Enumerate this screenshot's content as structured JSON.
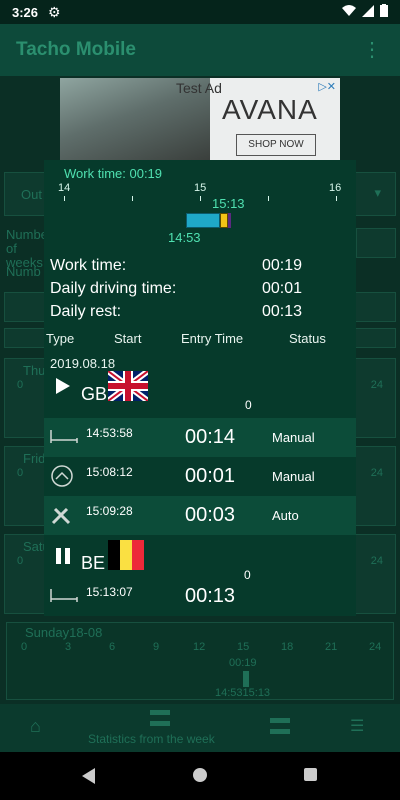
{
  "status_bar": {
    "time": "3:26"
  },
  "app_bar": {
    "title": "Tacho Mobile"
  },
  "ad": {
    "label": "Test Ad",
    "brand": "AVANA",
    "cta": "SHOP NOW"
  },
  "background": {
    "out_label": "Out",
    "number_weeks": "Number of weeks",
    "number": "Numb",
    "days": [
      "Thu",
      "Frid",
      "Satu"
    ],
    "hour_24": "24",
    "hour_0": "0"
  },
  "dialog": {
    "work_time_label": "Work time: 00:19",
    "timeline": {
      "ticks": [
        "14",
        "15",
        "16"
      ],
      "end_time": "15:13",
      "start_time": "14:53"
    },
    "summary": [
      {
        "label": "Work time:",
        "value": "00:19"
      },
      {
        "label": "Daily driving time:",
        "value": "00:01"
      },
      {
        "label": "Daily rest:",
        "value": "00:13"
      }
    ],
    "columns": [
      "Type",
      "Start",
      "Entry Time",
      "Status"
    ],
    "date": "2019.08.18",
    "country_start": {
      "code": "GB",
      "value": "0"
    },
    "rows": [
      {
        "icon": "bed-icon",
        "start": "14:53:58",
        "duration": "00:14",
        "status": "Manual"
      },
      {
        "icon": "steering-wheel-icon",
        "start": "15:08:12",
        "duration": "00:01",
        "status": "Manual"
      },
      {
        "icon": "tools-icon",
        "start": "15:09:28",
        "duration": "00:03",
        "status": "Auto"
      }
    ],
    "country_end": {
      "code": "BE",
      "value": "0"
    },
    "last_row": {
      "icon": "bed-icon",
      "start": "15:13:07",
      "duration": "00:13"
    }
  },
  "sunday": {
    "title": "Sunday18-08",
    "hours": [
      "0",
      "3",
      "6",
      "9",
      "12",
      "15",
      "18",
      "21",
      "24"
    ],
    "duration": "00:19",
    "range": "14:5315:13"
  },
  "bottom_nav": {
    "label": "Statistics from the week"
  }
}
